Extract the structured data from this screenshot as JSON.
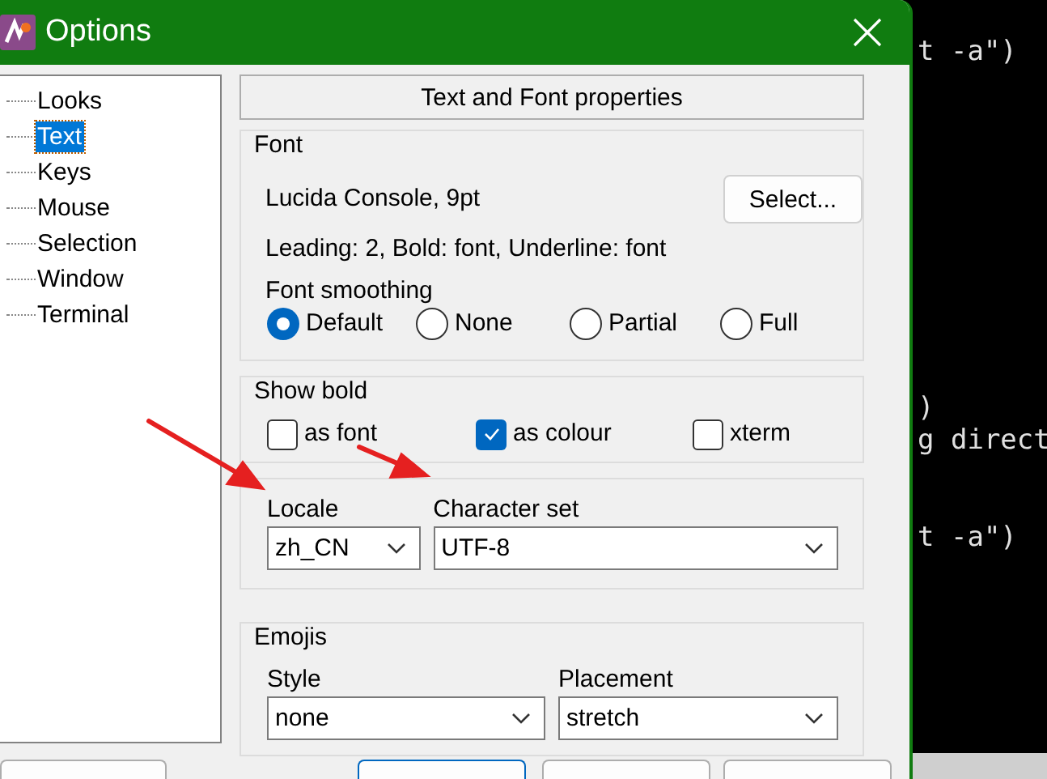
{
  "window": {
    "title": "Options"
  },
  "tree": {
    "items": [
      {
        "label": "Looks",
        "selected": false
      },
      {
        "label": "Text",
        "selected": true
      },
      {
        "label": "Keys",
        "selected": false
      },
      {
        "label": "Mouse",
        "selected": false
      },
      {
        "label": "Selection",
        "selected": false
      },
      {
        "label": "Window",
        "selected": false
      },
      {
        "label": "Terminal",
        "selected": false
      }
    ]
  },
  "page_header": "Text and Font properties",
  "font_group": {
    "title": "Font",
    "font_name": "Lucida Console, 9pt",
    "select_button": "Select...",
    "details": "Leading: 2, Bold: font, Underline: font",
    "smoothing_label": "Font smoothing",
    "smoothing_options": [
      {
        "label": "Default",
        "selected": true
      },
      {
        "label": "None",
        "selected": false
      },
      {
        "label": "Partial",
        "selected": false
      },
      {
        "label": "Full",
        "selected": false
      }
    ]
  },
  "show_bold": {
    "title": "Show bold",
    "options": [
      {
        "label": "as font",
        "checked": false
      },
      {
        "label": "as colour",
        "checked": true
      },
      {
        "label": "xterm",
        "checked": false
      }
    ]
  },
  "locale_group": {
    "fields": [
      {
        "label": "Locale",
        "value": "zh_CN"
      },
      {
        "label": "Character set",
        "value": "UTF-8"
      }
    ]
  },
  "emojis": {
    "title": "Emojis",
    "fields": [
      {
        "label": "Style",
        "value": "none"
      },
      {
        "label": "Placement",
        "value": "stretch"
      }
    ]
  },
  "terminal": {
    "lines": [
      "t -a\")",
      ")",
      "g direct",
      "t -a\")"
    ]
  }
}
